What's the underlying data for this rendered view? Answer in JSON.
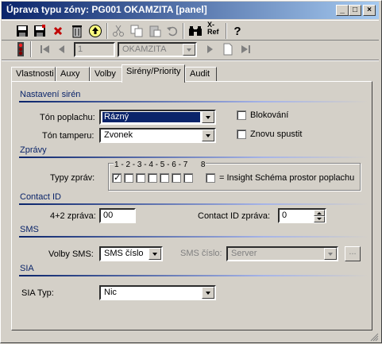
{
  "window": {
    "title": "Úprava typu zóny: PG001 OKAMZITA [panel]"
  },
  "titlebar_buttons": {
    "minimize": "_",
    "maximize": "□",
    "close": "×"
  },
  "toolbar": {
    "icons": [
      "save-icon",
      "save-as-icon",
      "delete-x-icon",
      "trash-icon",
      "upload-icon",
      "cut-icon",
      "copy-icon",
      "paste-icon",
      "undo-icon",
      "find-icon",
      "cross-ref-icon",
      "help-icon"
    ],
    "ref_label": "X-\nRef",
    "help_label": "?"
  },
  "navbar": {
    "record_number": "1",
    "record_name": "OKAMZITA"
  },
  "tabs": [
    {
      "label": "Vlastnosti",
      "active": false
    },
    {
      "label": "Auxy",
      "active": false
    },
    {
      "label": "Volby",
      "active": false
    },
    {
      "label": "Sirény/Priority",
      "active": true
    },
    {
      "label": "Audit",
      "active": false
    }
  ],
  "nastaveni_siren": {
    "title": "Nastavení sirén",
    "ton_poplachu_label": "Tón poplachu:",
    "ton_poplachu_value": "Rázný",
    "ton_tamperu_label": "Tón tamperu:",
    "ton_tamperu_value": "Zvonek",
    "blokovani_label": "Blokování",
    "blokovani_checked": false,
    "znovu_spustit_label": "Znovu spustit",
    "znovu_spustit_checked": false
  },
  "zpravy": {
    "title": "Zprávy",
    "numbers_header": "1 - 2 - 3 - 4 - 5 - 6 - 7      8",
    "typy_zprav_label": "Typy zpráv:",
    "checks": [
      true,
      false,
      false,
      false,
      false,
      false,
      false
    ],
    "check8": false,
    "insight_label": "= Insight Schéma prostor poplachu"
  },
  "contact_id": {
    "title": "Contact ID",
    "zprava_42_label": "4+2 zpráva:",
    "zprava_42_value": "00",
    "cid_zprava_label": "Contact ID zpráva:",
    "cid_zprava_value": "0"
  },
  "sms": {
    "title": "SMS",
    "volby_sms_label": "Volby SMS:",
    "volby_sms_value": "SMS číslo",
    "sms_cislo_label": "SMS číslo:",
    "sms_cislo_value": "Server",
    "browse_label": "..."
  },
  "sia": {
    "title": "SIA",
    "sia_typ_label": "SIA Typ:",
    "sia_typ_value": "Nic"
  },
  "colors": {
    "title_start": "#0a246a",
    "title_end": "#a6caf0",
    "face": "#d4d0c8",
    "group_title": "#0a246a"
  }
}
